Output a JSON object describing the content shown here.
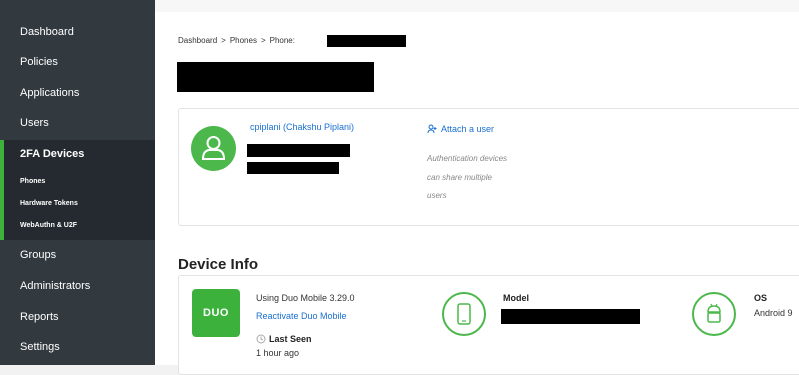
{
  "sidebar": {
    "items": [
      {
        "label": "Dashboard"
      },
      {
        "label": "Policies"
      },
      {
        "label": "Applications"
      },
      {
        "label": "Users"
      },
      {
        "label": "2FA Devices"
      },
      {
        "label": "Groups"
      },
      {
        "label": "Administrators"
      },
      {
        "label": "Reports"
      },
      {
        "label": "Settings"
      }
    ],
    "sub_items": [
      {
        "label": "Phones"
      },
      {
        "label": "Hardware Tokens"
      },
      {
        "label": "WebAuthn & U2F"
      }
    ]
  },
  "breadcrumb": {
    "items": [
      "Dashboard",
      "Phones",
      "Phone:"
    ],
    "separator": ">"
  },
  "user_card": {
    "user_link": "cpiplani (Chakshu Piplani)",
    "attach_label": "Attach a user",
    "hint_lines": [
      "Authentication devices",
      "can share multiple",
      "users"
    ]
  },
  "device_info": {
    "title": "Device Info",
    "app_text": "Using Duo Mobile 3.29.0",
    "reactivate_label": "Reactivate Duo Mobile",
    "last_seen_label": "Last Seen",
    "last_seen_value": "1 hour ago",
    "duo_logo_text": "DUO",
    "model_label": "Model",
    "os_label": "OS",
    "os_value": "Android 9"
  },
  "colors": {
    "accent_green": "#3cb23c",
    "link_blue": "#1a6fd0",
    "sidebar_bg": "#32393f"
  }
}
